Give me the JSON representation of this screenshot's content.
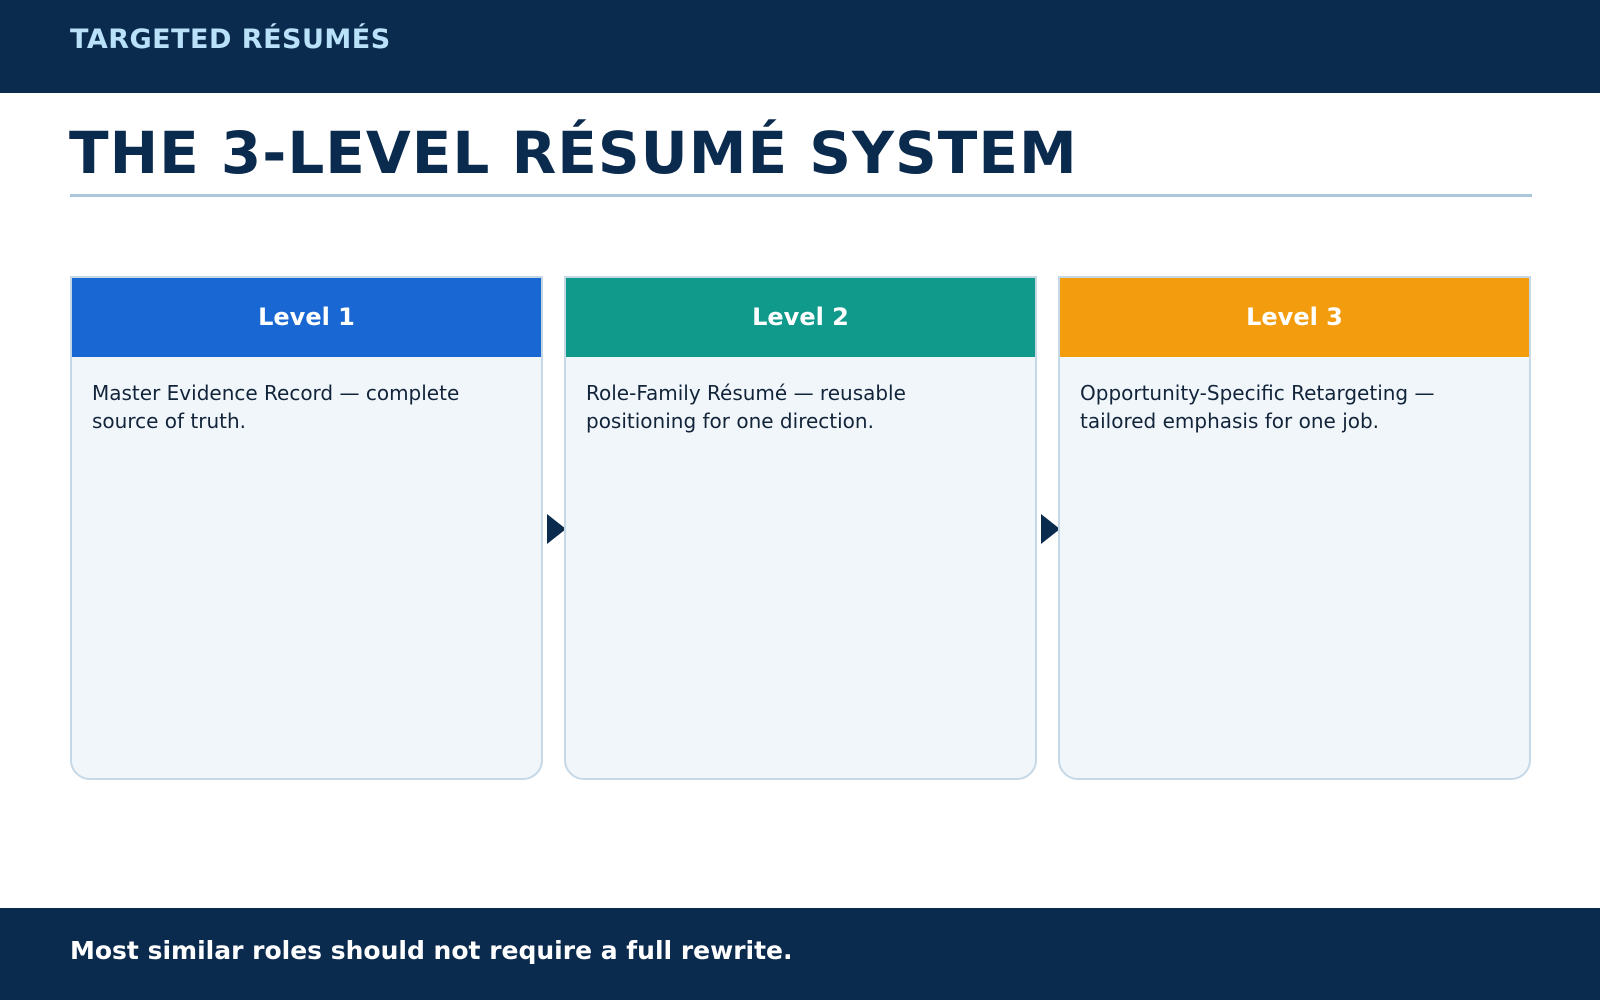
{
  "header": {
    "brand": "TARGETED RÉSUMÉS"
  },
  "title": "THE 3-LEVEL RÉSUMÉ SYSTEM",
  "levels": [
    {
      "label": "Level 1",
      "description": "Master Evidence Record — complete source of truth.",
      "color": "#1967d2"
    },
    {
      "label": "Level 2",
      "description": "Role-Family Résumé — reusable positioning for one direction.",
      "color": "#0f9a8c"
    },
    {
      "label": "Level 3",
      "description": "Opportunity-Specific Retargeting — tailored emphasis for one job.",
      "color": "#f39c0e"
    }
  ],
  "footer": {
    "takeaway": "Most similar roles should not require a full rewrite."
  },
  "icons": {
    "connector": "arrow-right-icon"
  },
  "colors": {
    "navy": "#0b2b4e",
    "brand_text": "#b9e1fa",
    "rule": "#a9c8de",
    "card_bg": "#f1f6fb",
    "card_border": "#c6d8e6"
  }
}
